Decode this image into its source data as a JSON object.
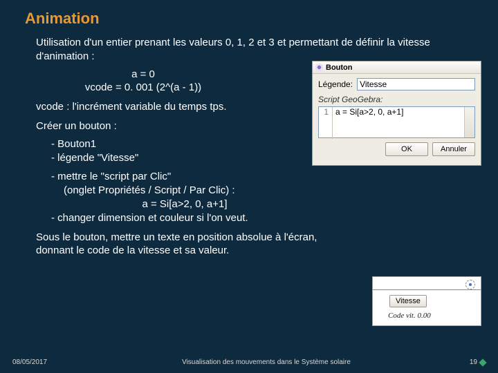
{
  "title": "Animation",
  "p1": "Utilisation  d'un entier prenant les valeurs 0, 1, 2 et 3 et permettant de définir la vitesse d'animation :",
  "eq1": "a = 0",
  "eq2": "vcode = 0. 001 (2^(a - 1))",
  "p2": "vcode : l'incrément variable du temps tps.",
  "p3": "Créer un bouton :",
  "b1": "- Bouton1",
  "b2": "- légende \"Vitesse\"",
  "b3": "- mettre le \"script par Clic\"",
  "b3b": "(onglet Propriétés / Script / Par Clic) :",
  "eq3": "a = Si[a>2, 0, a+1]",
  "b4": "- changer dimension et couleur si l'on veut.",
  "p4": "Sous le bouton, mettre un texte en position absolue à l'écran, donnant le code de la vitesse et sa valeur.",
  "dialog1": {
    "title": "Bouton",
    "legende_label": "Légende:",
    "legende_value": "Vitesse",
    "script_label": "Script GeoGebra:",
    "lineno": "1",
    "lineval": "a = Si[a>2, 0, a+1]",
    "ok": "OK",
    "cancel": "Annuler"
  },
  "inset2": {
    "button": "Vitesse",
    "code": "Code   vit. 0.00"
  },
  "footer": {
    "date": "08/05/2017",
    "title": "Visualisation des mouvements dans le Système solaire",
    "page": "19"
  }
}
